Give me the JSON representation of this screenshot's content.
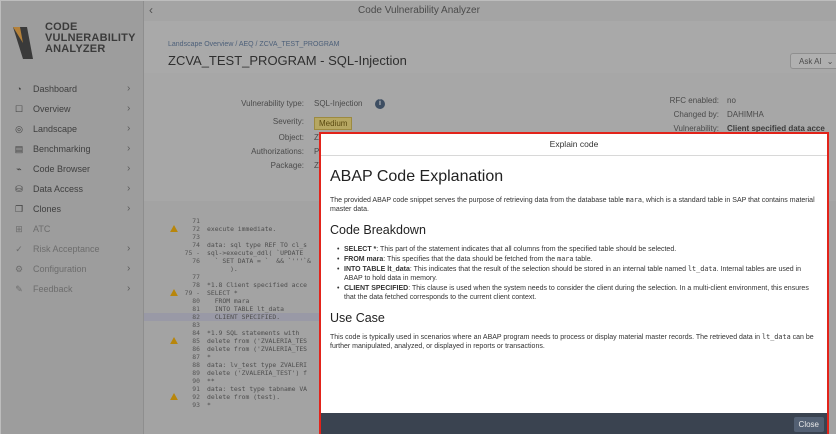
{
  "app": {
    "window_title": "Code Vulnerability Analyzer",
    "logo_lines": [
      "CODE",
      "VULNERABILITY",
      "ANALYZER"
    ]
  },
  "sidebar": {
    "items": [
      {
        "label": "Dashboard",
        "icon": "dashboard-icon",
        "has_arrow": true
      },
      {
        "label": "Overview",
        "icon": "overview-icon",
        "has_arrow": true
      },
      {
        "label": "Landscape",
        "icon": "landscape-icon",
        "has_arrow": true
      },
      {
        "label": "Benchmarking",
        "icon": "benchmarking-icon",
        "has_arrow": true
      },
      {
        "label": "Code Browser",
        "icon": "code-browser-icon",
        "has_arrow": true
      },
      {
        "label": "Data Access",
        "icon": "data-access-icon",
        "has_arrow": true
      },
      {
        "label": "Clones",
        "icon": "clones-icon",
        "has_arrow": true
      },
      {
        "label": "ATC",
        "icon": "atc-icon",
        "has_arrow": false
      },
      {
        "label": "Risk Acceptance",
        "icon": "risk-acceptance-icon",
        "has_arrow": true
      },
      {
        "label": "Configuration",
        "icon": "configuration-icon",
        "has_arrow": true
      },
      {
        "label": "Feedback",
        "icon": "feedback-icon",
        "has_arrow": true
      }
    ]
  },
  "header": {
    "breadcrumb": "Landscape Overview / AEQ / ZCVA_TEST_PROGRAM",
    "title": "ZCVA_TEST_PROGRAM - SQL-Injection",
    "ask_ai": "Ask AI"
  },
  "details": {
    "vuln_type_label": "Vulnerability type:",
    "vuln_type_value": "SQL-Injection",
    "severity_label": "Severity:",
    "severity_value": "Medium",
    "object_label": "Object:",
    "object_value": "Z",
    "authorizations_label": "Authorizations:",
    "authorizations_value": "P",
    "package_label": "Package:",
    "package_value": "Z",
    "rfc_label": "RFC enabled:",
    "rfc_value": "no",
    "changed_label": "Changed by:",
    "changed_value": "DAHIMHA",
    "vulnerability_label": "Vulnerability:",
    "vulnerability_value": "Client specified data acce"
  },
  "code": {
    "lines": [
      {
        "n": "71",
        "t": "",
        "warn": false,
        "hl": false
      },
      {
        "n": "72",
        "t": "execute immediate.",
        "warn": true,
        "hl": false
      },
      {
        "n": "73",
        "t": "",
        "warn": false,
        "hl": false
      },
      {
        "n": "74",
        "t": "data: sql type REF TO cl_s",
        "warn": false,
        "hl": false
      },
      {
        "n": "75 -",
        "t": "sql->execute_ddl( `UPDATE ",
        "warn": false,
        "hl": false
      },
      {
        "n": "76",
        "t": "  ` SET DATA = `  && `'''`&",
        "warn": false,
        "hl": false
      },
      {
        "n": "",
        "t": "      ).",
        "warn": false,
        "hl": false
      },
      {
        "n": "77",
        "t": "",
        "warn": false,
        "hl": false
      },
      {
        "n": "78",
        "t": "*1.8 Client specified acce",
        "warn": false,
        "hl": false
      },
      {
        "n": "79 -",
        "t": "SELECT *",
        "warn": true,
        "hl": false
      },
      {
        "n": "80",
        "t": "  FROM mara",
        "warn": false,
        "hl": false
      },
      {
        "n": "81",
        "t": "  INTO TABLE lt_data",
        "warn": false,
        "hl": false
      },
      {
        "n": "82",
        "t": "  CLIENT SPECIFIED.",
        "warn": false,
        "hl": true
      },
      {
        "n": "83",
        "t": "",
        "warn": false,
        "hl": false
      },
      {
        "n": "84",
        "t": "*1.9 SQL statements with ",
        "warn": false,
        "hl": false
      },
      {
        "n": "85",
        "t": "delete from ('ZVALERIA_TES",
        "warn": true,
        "hl": false
      },
      {
        "n": "86",
        "t": "delete from ('ZVALERIA_TES",
        "warn": false,
        "hl": false
      },
      {
        "n": "87",
        "t": "*",
        "warn": false,
        "hl": false
      },
      {
        "n": "88",
        "t": "data: lv_test type ZVALERI",
        "warn": false,
        "hl": false
      },
      {
        "n": "89",
        "t": "delete ('ZVALERIA_TEST') f",
        "warn": false,
        "hl": false
      },
      {
        "n": "90",
        "t": "**",
        "warn": false,
        "hl": false
      },
      {
        "n": "91",
        "t": "data: test type tabname VA",
        "warn": false,
        "hl": false
      },
      {
        "n": "92",
        "t": "delete from (test).",
        "warn": true,
        "hl": false
      },
      {
        "n": "93",
        "t": "*",
        "warn": false,
        "hl": false
      }
    ]
  },
  "modal": {
    "header": "Explain code",
    "title": "ABAP Code Explanation",
    "intro_a": "The provided ABAP code snippet serves the purpose of retrieving data from the database table ",
    "intro_code": "mara",
    "intro_b": ", which is a standard table in SAP that contains material master data.",
    "breakdown_heading": "Code Breakdown",
    "bullets": [
      {
        "bold": "SELECT *",
        "text_a": ": This part of the statement indicates that all columns from the specified table should be selected.",
        "code": "",
        "text_b": ""
      },
      {
        "bold": "FROM mara",
        "text_a": ": This specifies that the data should be fetched from the ",
        "code": "mara",
        "text_b": " table."
      },
      {
        "bold": "INTO TABLE lt_data",
        "text_a": ": This indicates that the result of the selection should be stored in an internal table named ",
        "code": "lt_data",
        "text_b": ". Internal tables are used in ABAP to hold data in memory."
      },
      {
        "bold": "CLIENT SPECIFIED",
        "text_a": ": This clause is used when the system needs to consider the client during the selection. In a multi-client environment, this ensures that the data fetched corresponds to the current client context.",
        "code": "",
        "text_b": ""
      }
    ],
    "usecase_heading": "Use Case",
    "usecase_a": "This code is typically used in scenarios where an ABAP program needs to process or display material master records. The retrieved data in ",
    "usecase_code": "lt_data",
    "usecase_b": " can be further manipulated, analyzed, or displayed in reports or transactions.",
    "close_label": "Close"
  },
  "colors": {
    "modal_border": "#e2231a",
    "footer": "#3a4350",
    "warning": "#b8860b"
  }
}
